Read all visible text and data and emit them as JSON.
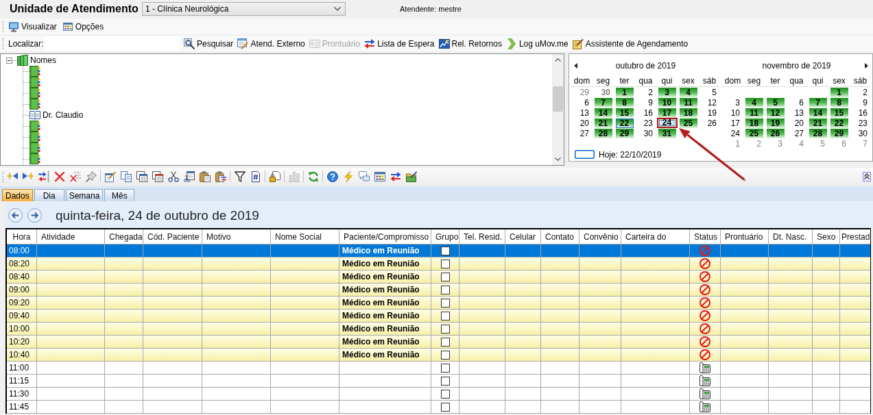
{
  "header": {
    "title": "Unidade de Atendimento",
    "unit_select": {
      "value": "1 - Clínica Neurológica"
    },
    "attendant": "Atendente: mestre"
  },
  "menu": [
    {
      "label": "Visualizar",
      "kind": "monitor"
    },
    {
      "label": "Opções",
      "kind": "options"
    }
  ],
  "find_bar": {
    "label": "Localizar:",
    "actions": [
      {
        "label": "Pesquisar",
        "kind": "search",
        "disabled": false
      },
      {
        "label": "Atend. Externo",
        "kind": "form-pencil",
        "disabled": false
      },
      {
        "label": "Prontuário",
        "kind": "card",
        "disabled": true
      },
      {
        "label": "Lista de Espera",
        "kind": "swap-arrows",
        "disabled": false
      },
      {
        "label": "Rel. Retornos",
        "kind": "chart-image",
        "disabled": false
      },
      {
        "label": "Log uMov.me",
        "kind": "chevron",
        "disabled": false
      },
      {
        "label": "Assistente de Agendamento",
        "kind": "notepad-pencil",
        "disabled": false
      }
    ]
  },
  "tree": {
    "label": "Nomes",
    "expanded": true,
    "children": [
      {
        "kind": "book"
      },
      {
        "kind": "book"
      },
      {
        "kind": "book"
      },
      {
        "kind": "book"
      },
      {
        "kind": "open-book",
        "label": "Dr. Claudio"
      },
      {
        "kind": "book"
      },
      {
        "kind": "book"
      },
      {
        "kind": "book"
      },
      {
        "kind": "book"
      }
    ]
  },
  "calendar": {
    "months": [
      {
        "title": "outubro de 2019",
        "weekdays": [
          "dom",
          "seg",
          "ter",
          "qua",
          "qui",
          "sex",
          "sáb"
        ],
        "weeks": [
          [
            {
              "day": "29",
              "outside": true,
              "marked": false,
              "today": false,
              "selected": false
            },
            {
              "day": "30",
              "outside": true,
              "marked": true,
              "today": false,
              "selected": false
            },
            {
              "day": "1",
              "outside": false,
              "marked": true,
              "today": false,
              "selected": false
            },
            {
              "day": "2",
              "outside": false,
              "marked": false,
              "today": false,
              "selected": false
            },
            {
              "day": "3",
              "outside": false,
              "marked": true,
              "today": false,
              "selected": false
            },
            {
              "day": "4",
              "outside": false,
              "marked": true,
              "today": false,
              "selected": false
            },
            {
              "day": "5",
              "outside": false,
              "marked": false,
              "today": false,
              "selected": false
            }
          ],
          [
            {
              "day": "6",
              "outside": false,
              "marked": false,
              "today": false,
              "selected": false
            },
            {
              "day": "7",
              "outside": false,
              "marked": true,
              "today": false,
              "selected": false
            },
            {
              "day": "8",
              "outside": false,
              "marked": true,
              "today": false,
              "selected": false
            },
            {
              "day": "9",
              "outside": false,
              "marked": false,
              "today": false,
              "selected": false
            },
            {
              "day": "10",
              "outside": false,
              "marked": true,
              "today": false,
              "selected": false
            },
            {
              "day": "11",
              "outside": false,
              "marked": true,
              "today": false,
              "selected": false
            },
            {
              "day": "12",
              "outside": false,
              "marked": false,
              "today": false,
              "selected": false
            }
          ],
          [
            {
              "day": "13",
              "outside": false,
              "marked": false,
              "today": false,
              "selected": false
            },
            {
              "day": "14",
              "outside": false,
              "marked": true,
              "today": false,
              "selected": false
            },
            {
              "day": "15",
              "outside": false,
              "marked": true,
              "today": false,
              "selected": false
            },
            {
              "day": "16",
              "outside": false,
              "marked": false,
              "today": false,
              "selected": false
            },
            {
              "day": "17",
              "outside": false,
              "marked": true,
              "today": false,
              "selected": false
            },
            {
              "day": "18",
              "outside": false,
              "marked": true,
              "today": false,
              "selected": false
            },
            {
              "day": "19",
              "outside": false,
              "marked": false,
              "today": false,
              "selected": false
            }
          ],
          [
            {
              "day": "20",
              "outside": false,
              "marked": false,
              "today": false,
              "selected": false
            },
            {
              "day": "21",
              "outside": false,
              "marked": true,
              "today": false,
              "selected": false
            },
            {
              "day": "22",
              "outside": false,
              "marked": true,
              "today": true,
              "selected": false
            },
            {
              "day": "23",
              "outside": false,
              "marked": false,
              "today": false,
              "selected": false
            },
            {
              "day": "24",
              "outside": false,
              "marked": true,
              "today": false,
              "selected": true
            },
            {
              "day": "25",
              "outside": false,
              "marked": true,
              "today": false,
              "selected": false
            },
            {
              "day": "26",
              "outside": false,
              "marked": false,
              "today": false,
              "selected": false
            }
          ],
          [
            {
              "day": "27",
              "outside": false,
              "marked": false,
              "today": false,
              "selected": false
            },
            {
              "day": "28",
              "outside": false,
              "marked": true,
              "today": false,
              "selected": false
            },
            {
              "day": "29",
              "outside": false,
              "marked": true,
              "today": false,
              "selected": false
            },
            {
              "day": "30",
              "outside": false,
              "marked": false,
              "today": false,
              "selected": false
            },
            {
              "day": "31",
              "outside": false,
              "marked": true,
              "today": false,
              "selected": false
            }
          ]
        ]
      },
      {
        "title": "novembro de 2019",
        "weekdays": [
          "dom",
          "seg",
          "ter",
          "qua",
          "qui",
          "sex",
          "sáb"
        ],
        "weeks": [
          [
            {
              "day": "1",
              "outside": false,
              "marked": true,
              "today": false,
              "selected": false
            },
            {
              "day": "2",
              "outside": false,
              "marked": false,
              "today": false,
              "selected": false
            }
          ],
          [
            {
              "day": "3",
              "outside": false,
              "marked": false,
              "today": false,
              "selected": false
            },
            {
              "day": "4",
              "outside": false,
              "marked": true,
              "today": false,
              "selected": false
            },
            {
              "day": "5",
              "outside": false,
              "marked": true,
              "today": false,
              "selected": false
            },
            {
              "day": "6",
              "outside": false,
              "marked": false,
              "today": false,
              "selected": false
            },
            {
              "day": "7",
              "outside": false,
              "marked": true,
              "today": false,
              "selected": false
            },
            {
              "day": "8",
              "outside": false,
              "marked": true,
              "today": false,
              "selected": false
            },
            {
              "day": "9",
              "outside": false,
              "marked": false,
              "today": false,
              "selected": false
            }
          ],
          [
            {
              "day": "10",
              "outside": false,
              "marked": false,
              "today": false,
              "selected": false
            },
            {
              "day": "11",
              "outside": false,
              "marked": true,
              "today": false,
              "selected": false
            },
            {
              "day": "12",
              "outside": false,
              "marked": true,
              "today": false,
              "selected": false
            },
            {
              "day": "13",
              "outside": false,
              "marked": false,
              "today": false,
              "selected": false
            },
            {
              "day": "14",
              "outside": false,
              "marked": true,
              "today": false,
              "selected": false
            },
            {
              "day": "15",
              "outside": false,
              "marked": true,
              "today": false,
              "selected": false
            },
            {
              "day": "16",
              "outside": false,
              "marked": false,
              "today": false,
              "selected": false
            }
          ],
          [
            {
              "day": "17",
              "outside": false,
              "marked": false,
              "today": false,
              "selected": false
            },
            {
              "day": "18",
              "outside": false,
              "marked": true,
              "today": false,
              "selected": false
            },
            {
              "day": "19",
              "outside": false,
              "marked": true,
              "today": false,
              "selected": false
            },
            {
              "day": "20",
              "outside": false,
              "marked": false,
              "today": false,
              "selected": false
            },
            {
              "day": "21",
              "outside": false,
              "marked": true,
              "today": false,
              "selected": false
            },
            {
              "day": "22",
              "outside": false,
              "marked": true,
              "today": false,
              "selected": false
            },
            {
              "day": "23",
              "outside": false,
              "marked": false,
              "today": false,
              "selected": false
            }
          ],
          [
            {
              "day": "24",
              "outside": false,
              "marked": false,
              "today": false,
              "selected": false
            },
            {
              "day": "25",
              "outside": false,
              "marked": true,
              "today": false,
              "selected": false
            },
            {
              "day": "26",
              "outside": false,
              "marked": true,
              "today": false,
              "selected": false
            },
            {
              "day": "27",
              "outside": false,
              "marked": false,
              "today": false,
              "selected": false
            },
            {
              "day": "28",
              "outside": false,
              "marked": true,
              "today": false,
              "selected": false
            },
            {
              "day": "29",
              "outside": false,
              "marked": true,
              "today": false,
              "selected": false
            },
            {
              "day": "30",
              "outside": false,
              "marked": false,
              "today": false,
              "selected": false
            }
          ],
          [
            {
              "day": "1",
              "outside": true,
              "marked": false,
              "today": false,
              "selected": false
            },
            {
              "day": "2",
              "outside": true,
              "marked": false,
              "today": false,
              "selected": false
            },
            {
              "day": "3",
              "outside": true,
              "marked": false,
              "today": false,
              "selected": false
            },
            {
              "day": "4",
              "outside": true,
              "marked": false,
              "today": false,
              "selected": false
            },
            {
              "day": "5",
              "outside": true,
              "marked": false,
              "today": false,
              "selected": false
            },
            {
              "day": "6",
              "outside": true,
              "marked": false,
              "today": false,
              "selected": false
            },
            {
              "day": "7",
              "outside": true,
              "marked": false,
              "today": false,
              "selected": false
            }
          ]
        ]
      }
    ],
    "today_label": "Hoje: 22/10/2019"
  },
  "toolbar": [
    {
      "kind": "star-left",
      "disabled": false
    },
    {
      "kind": "star-right",
      "disabled": false
    },
    {
      "kind": "move-arrows",
      "disabled": false
    },
    {
      "kind": "delete",
      "disabled": false
    },
    {
      "kind": "delete-rows",
      "disabled": false
    },
    {
      "kind": "pin",
      "disabled": false
    },
    {
      "kind": "separator"
    },
    {
      "kind": "edit",
      "disabled": false
    },
    {
      "kind": "copy",
      "disabled": false
    },
    {
      "kind": "calendar-stack",
      "disabled": false
    },
    {
      "kind": "calendar-pages",
      "disabled": false
    },
    {
      "kind": "scissors",
      "disabled": false
    },
    {
      "kind": "calendar-scissors",
      "disabled": false
    },
    {
      "kind": "paste",
      "disabled": false
    },
    {
      "kind": "paste-special",
      "disabled": false
    },
    {
      "kind": "separator"
    },
    {
      "kind": "filter",
      "disabled": false
    },
    {
      "kind": "doc-hash",
      "disabled": false
    },
    {
      "kind": "separator"
    },
    {
      "kind": "doc-lock",
      "disabled": false
    },
    {
      "kind": "separator"
    },
    {
      "kind": "bar-chart",
      "disabled": true
    },
    {
      "kind": "separator"
    },
    {
      "kind": "refresh",
      "disabled": false
    },
    {
      "kind": "separator"
    },
    {
      "kind": "help",
      "disabled": false
    },
    {
      "kind": "lightning",
      "disabled": false
    },
    {
      "kind": "chat",
      "disabled": false
    },
    {
      "kind": "calendar-grid",
      "disabled": false
    },
    {
      "kind": "swap-arrows",
      "disabled": false
    },
    {
      "kind": "folder-pencil",
      "disabled": false
    }
  ],
  "view_tabs": [
    {
      "label": "Dados",
      "selected": true
    },
    {
      "label": "Dia",
      "selected": false
    },
    {
      "label": "Semana",
      "selected": false
    },
    {
      "label": "Mês",
      "selected": false
    }
  ],
  "day_view": {
    "title": "quinta-feira, 24 de outubro de 2019",
    "columns": [
      "Hora",
      "Atividade",
      "Chegada",
      "Cód. Paciente",
      "Motivo",
      "Nome Social",
      "Paciente/Compromisso",
      "Grupo",
      "Tel. Resid.",
      "Celular",
      "Contato",
      "Convênio",
      "Carteira do",
      "Status",
      "Prontuário",
      "Dt. Nasc.",
      "Sexo",
      "Prestad"
    ],
    "rows": [
      {
        "time": "08:00",
        "patient": "Médico em Reunião",
        "kind": "meeting",
        "checked": false,
        "selected": true
      },
      {
        "time": "08:20",
        "patient": "Médico em Reunião",
        "kind": "meeting",
        "checked": false,
        "selected": false
      },
      {
        "time": "08:40",
        "patient": "Médico em Reunião",
        "kind": "meeting",
        "checked": false,
        "selected": false
      },
      {
        "time": "09:00",
        "patient": "Médico em Reunião",
        "kind": "meeting",
        "checked": false,
        "selected": false
      },
      {
        "time": "09:20",
        "patient": "Médico em Reunião",
        "kind": "meeting",
        "checked": false,
        "selected": false
      },
      {
        "time": "09:40",
        "patient": "Médico em Reunião",
        "kind": "meeting",
        "checked": false,
        "selected": false
      },
      {
        "time": "10:00",
        "patient": "Médico em Reunião",
        "kind": "meeting",
        "checked": false,
        "selected": false
      },
      {
        "time": "10:20",
        "patient": "Médico em Reunião",
        "kind": "meeting",
        "checked": false,
        "selected": false
      },
      {
        "time": "10:40",
        "patient": "Médico em Reunião",
        "kind": "meeting",
        "checked": false,
        "selected": false
      },
      {
        "time": "11:00",
        "kind": "free",
        "checked": false,
        "selected": false
      },
      {
        "time": "11:15",
        "kind": "free",
        "checked": false,
        "selected": false
      },
      {
        "time": "11:30",
        "kind": "free",
        "checked": false,
        "selected": false
      },
      {
        "time": "11:45",
        "kind": "free",
        "checked": false,
        "selected": false
      }
    ]
  }
}
